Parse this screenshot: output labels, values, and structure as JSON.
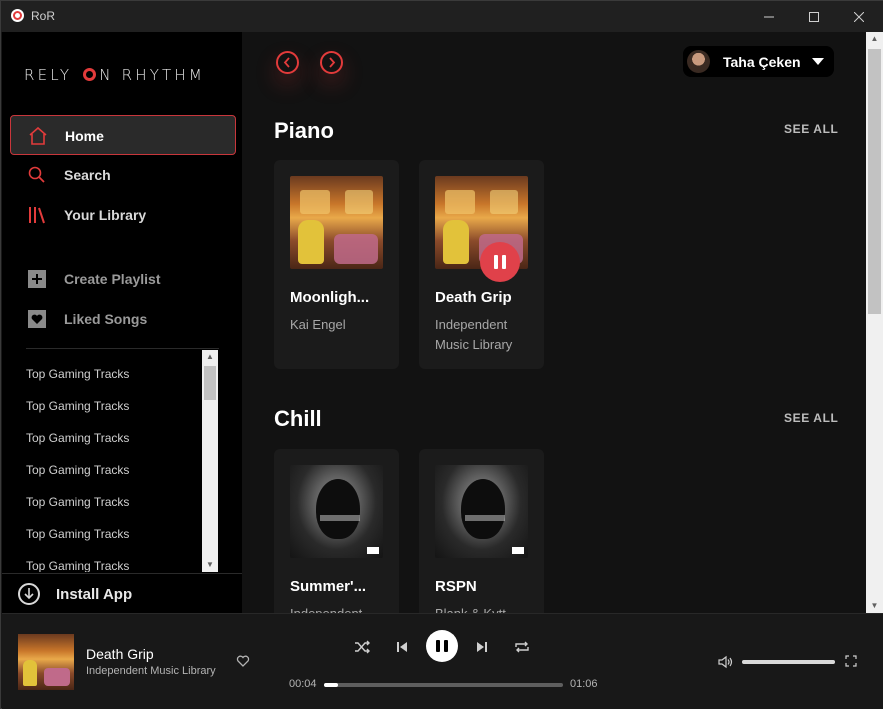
{
  "window": {
    "title": "RoR",
    "minimize": "—",
    "maximize": "☐",
    "close": "✕"
  },
  "sidebar": {
    "logo": {
      "part1": "RELY ",
      "part2": "N RHYTHM"
    },
    "nav": [
      {
        "label": "Home",
        "icon": "home-icon",
        "active": true
      },
      {
        "label": "Search",
        "icon": "search-icon"
      },
      {
        "label": "Your Library",
        "icon": "library-icon"
      },
      {
        "label": "Create Playlist",
        "icon": "plus-icon"
      },
      {
        "label": "Liked Songs",
        "icon": "heart-icon"
      }
    ],
    "playlists": [
      "Top Gaming Tracks",
      "Top Gaming Tracks",
      "Top Gaming Tracks",
      "Top Gaming Tracks",
      "Top Gaming Tracks",
      "Top Gaming Tracks",
      "Top Gaming Tracks"
    ],
    "install": "Install App"
  },
  "header": {
    "user_name": "Taha Çeken"
  },
  "sections": [
    {
      "title": "Piano",
      "see_all": "SEE ALL",
      "cards": [
        {
          "title": "Moonligh...",
          "subtitle": "Kai Engel",
          "cover": "piano"
        },
        {
          "title": "Death Grip",
          "subtitle": "Independent Music Library",
          "cover": "piano",
          "playing": true
        }
      ]
    },
    {
      "title": "Chill",
      "see_all": "SEE ALL",
      "cards": [
        {
          "title": "Summer'...",
          "subtitle": "Independent",
          "cover": "chill"
        },
        {
          "title": "RSPN",
          "subtitle": "Blank & Kytt",
          "cover": "chill"
        }
      ]
    }
  ],
  "player": {
    "title": "Death Grip",
    "artist": "Independent Music Library",
    "elapsed": "00:04",
    "duration": "01:06",
    "progress": 0.06,
    "volume": 1.0
  },
  "colors": {
    "accent": "#e23b3b",
    "background": "#121212",
    "sidebar": "#000000"
  }
}
